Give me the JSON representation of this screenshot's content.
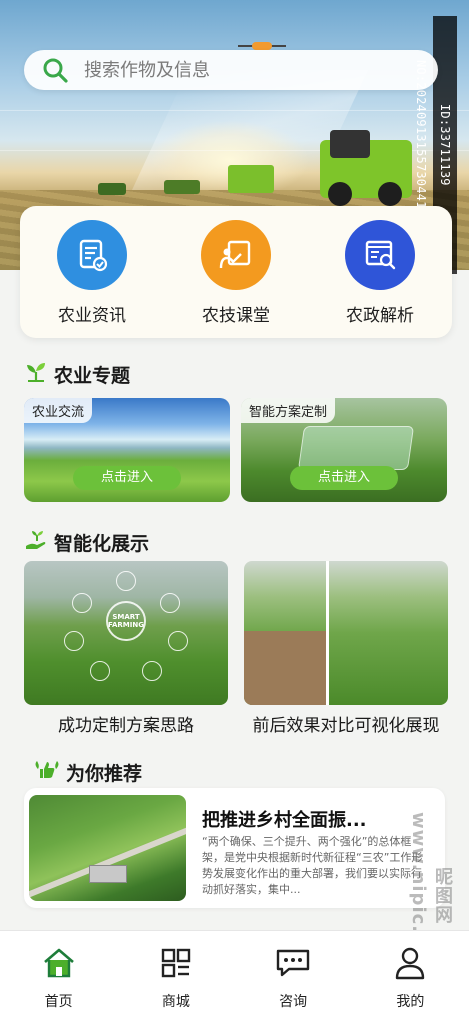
{
  "search": {
    "placeholder": "搜索作物及信息"
  },
  "side_id": "ID:33711139 NO:20240913155730441100",
  "services": [
    {
      "label": "农业资讯",
      "icon": "document-icon",
      "color": "#2f8fe0"
    },
    {
      "label": "农技课堂",
      "icon": "classroom-icon",
      "color": "#f39a1f"
    },
    {
      "label": "农政解析",
      "icon": "analysis-icon",
      "color": "#2f55d8"
    }
  ],
  "topics": {
    "title": "农业专题",
    "items": [
      {
        "tag": "农业交流",
        "button": "点击进入"
      },
      {
        "tag": "智能方案定制",
        "button": "点击进入"
      }
    ]
  },
  "smart": {
    "title": "智能化展示",
    "items": [
      {
        "caption": "成功定制方案思路",
        "hub_text": "SMART FARMING"
      },
      {
        "caption": "前后效果对比可视化展现"
      }
    ]
  },
  "recommend": {
    "title": "为你推荐",
    "item": {
      "title": "把推进乡村全面振...",
      "desc": "“两个确保、三个提升、两个强化”的总体框架，是党中央根据新时代新征程“三农”工作形势发展变化作出的重大部署，我们要以实际行动抓好落实，集中..."
    }
  },
  "watermark": "昵图网 www.nipic.com",
  "tabbar": [
    {
      "label": "首页",
      "icon": "home-icon",
      "active": true
    },
    {
      "label": "商城",
      "icon": "grid-icon",
      "active": false
    },
    {
      "label": "咨询",
      "icon": "chat-icon",
      "active": false
    },
    {
      "label": "我的",
      "icon": "user-icon",
      "active": false
    }
  ],
  "colors": {
    "accent": "#4caf2a",
    "button_green": "#6cc13a"
  }
}
